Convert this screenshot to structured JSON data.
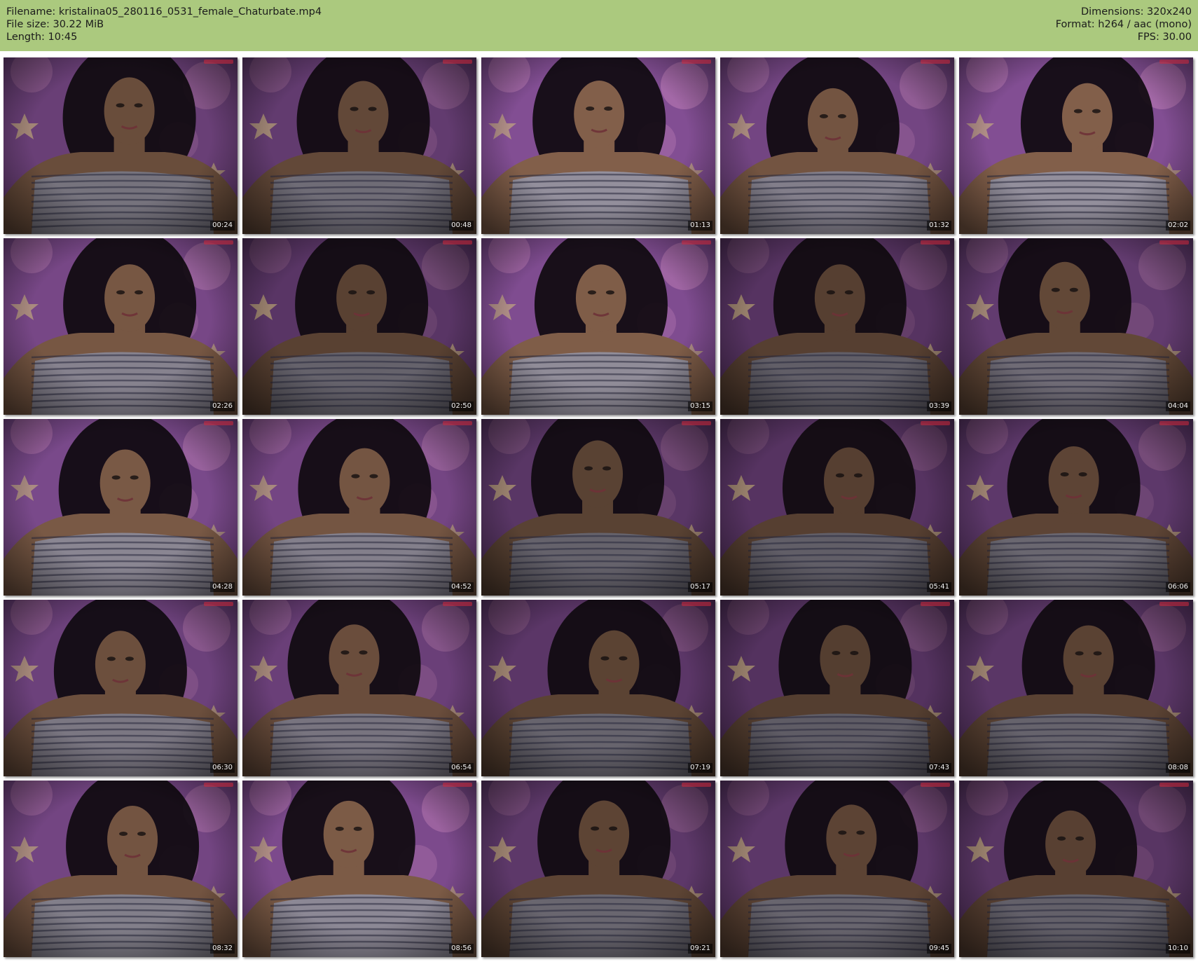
{
  "header": {
    "filename": "Filename: kristalina05_280116_0531_female_Chaturbate.mp4",
    "filesize": "File size: 30.22 MiB",
    "length": "Length: 10:45",
    "dimensions": "Dimensions: 320x240",
    "format": "Format: h264 / aac (mono)",
    "fps": "FPS: 30.00"
  },
  "colors": {
    "header_background": "#abc97e",
    "page_background": "#ffffff"
  },
  "thumbnails": [
    {
      "time": "00:24"
    },
    {
      "time": "00:48"
    },
    {
      "time": "01:13"
    },
    {
      "time": "01:32"
    },
    {
      "time": "02:02"
    },
    {
      "time": "02:26"
    },
    {
      "time": "02:50"
    },
    {
      "time": "03:15"
    },
    {
      "time": "03:39"
    },
    {
      "time": "04:04"
    },
    {
      "time": "04:28"
    },
    {
      "time": "04:52"
    },
    {
      "time": "05:17"
    },
    {
      "time": "05:41"
    },
    {
      "time": "06:06"
    },
    {
      "time": "06:30"
    },
    {
      "time": "06:54"
    },
    {
      "time": "07:19"
    },
    {
      "time": "07:43"
    },
    {
      "time": "08:08"
    },
    {
      "time": "08:32"
    },
    {
      "time": "08:56"
    },
    {
      "time": "09:21"
    },
    {
      "time": "09:45"
    },
    {
      "time": "10:10"
    }
  ]
}
